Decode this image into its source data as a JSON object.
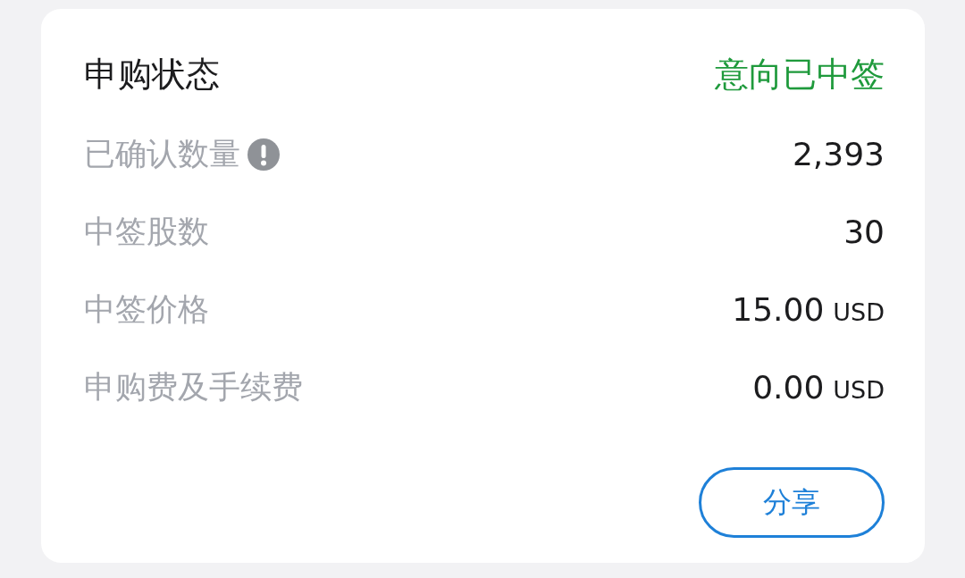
{
  "card": {
    "title": "申购状态",
    "status": {
      "text": "意向已中签",
      "kind": "success"
    },
    "rows": [
      {
        "label": "已确认数量",
        "info": true,
        "value": "2,393"
      },
      {
        "label": "中签股数",
        "info": false,
        "value": "30"
      },
      {
        "label": "中签价格",
        "info": false,
        "value": "15.00",
        "unit": "USD"
      },
      {
        "label": "申购费及手续费",
        "info": false,
        "value": "0.00",
        "unit": "USD"
      }
    ],
    "button": "分享"
  }
}
